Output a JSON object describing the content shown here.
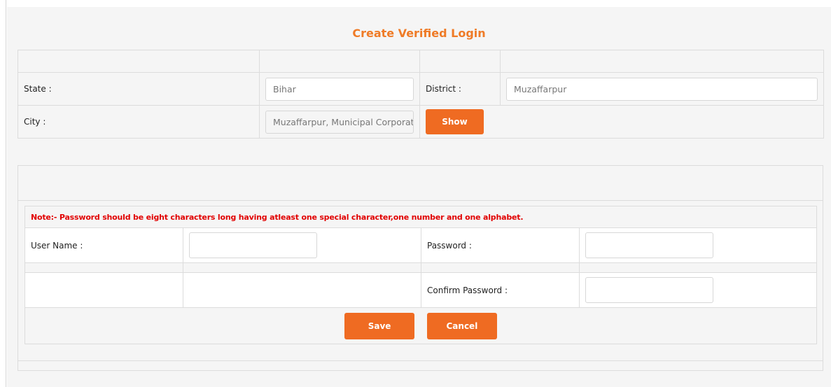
{
  "page": {
    "title": "Create Verified Login"
  },
  "location": {
    "state_label": "State :",
    "state_value": "Bihar",
    "district_label": "District :",
    "district_value": "Muzaffarpur",
    "city_label": "City :",
    "city_value": "Muzaffarpur, Municipal Corporation",
    "show_label": "Show"
  },
  "login": {
    "note": "Note:- Password should be eight characters long having atleast one special character,one number and one alphabet.",
    "username_label": "User Name :",
    "username_value": "",
    "password_label": "Password :",
    "password_value": "",
    "confirm_label": "Confirm Password :",
    "confirm_value": "",
    "save_label": "Save",
    "cancel_label": "Cancel"
  },
  "colors": {
    "accent": "#ef6b22",
    "title": "#ef7b27",
    "note": "#e10000"
  }
}
